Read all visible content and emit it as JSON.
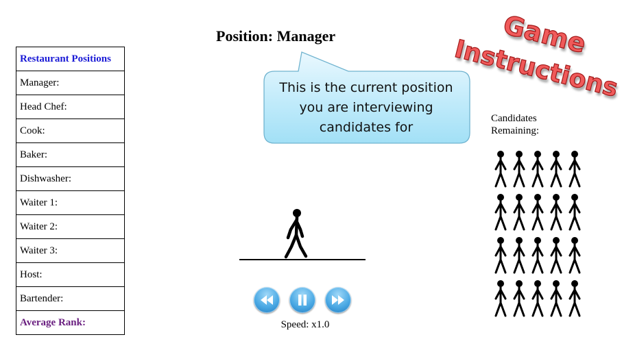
{
  "title": "Position: Manager",
  "positions_table": {
    "header": "Restaurant Positions",
    "rows": [
      "Manager:",
      "Head Chef:",
      "Cook:",
      "Baker:",
      "Dishwasher:",
      "Waiter 1:",
      "Waiter 2:",
      "Waiter 3:",
      "Host:",
      "Bartender:"
    ],
    "footer": "Average Rank:"
  },
  "callout": {
    "line1": "This is the current position",
    "line2": "you are interviewing",
    "line3": "candidates for"
  },
  "instructions_button": {
    "line1": "Game",
    "line2": "Instructions",
    "color": "#f05a5a"
  },
  "candidates": {
    "label_line1": "Candidates",
    "label_line2": "Remaining:",
    "count": 20
  },
  "playback": {
    "speed_label": "Speed: x1.0",
    "buttons": [
      "rewind-icon",
      "pause-icon",
      "fast-forward-icon"
    ],
    "accent": "#4ba9e4"
  }
}
